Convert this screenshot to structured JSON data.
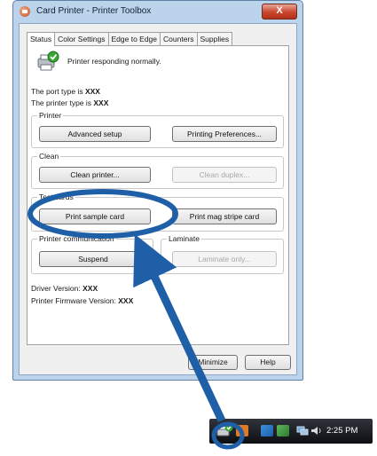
{
  "window": {
    "title": "Card Printer - Printer Toolbox",
    "close_label": "X"
  },
  "tabs": [
    {
      "label": "Status",
      "active": true
    },
    {
      "label": "Color Settings",
      "active": false
    },
    {
      "label": "Edge to Edge",
      "active": false
    },
    {
      "label": "Counters",
      "active": false
    },
    {
      "label": "Supplies",
      "active": false
    }
  ],
  "status": {
    "message": "Printer responding normally.",
    "port_prefix": "The port type is ",
    "port_value": "XXX",
    "printer_type_prefix": "The printer type is ",
    "printer_type_value": "XXX"
  },
  "groups": {
    "printer": {
      "label": "Printer",
      "advanced_setup": "Advanced setup",
      "printing_prefs": "Printing Preferences..."
    },
    "clean": {
      "label": "Clean",
      "clean_printer": "Clean printer...",
      "clean_duplex": "Clean duplex..."
    },
    "test_cards": {
      "label": "Test cards",
      "print_sample": "Print sample card",
      "print_mag": "Print mag stripe card"
    },
    "printer_comm": {
      "label": "Printer communication",
      "suspend": "Suspend"
    },
    "laminate": {
      "label": "Laminate",
      "laminate_only": "Laminate only..."
    }
  },
  "versions": {
    "driver_prefix": "Driver Version: ",
    "driver_value": "XXX",
    "firmware_prefix": "Printer Firmware Version: ",
    "firmware_value": "XXX"
  },
  "footer": {
    "minimize_label": "Minimize",
    "help_label": "Help"
  },
  "taskbar": {
    "time": "2:25 PM"
  },
  "annotation": {
    "color": "#1f5fa8"
  }
}
